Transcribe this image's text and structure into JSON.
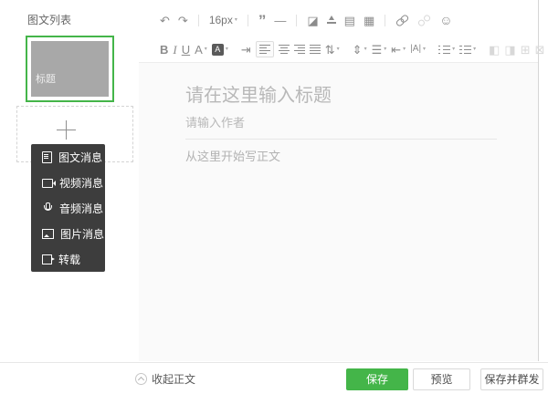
{
  "sidebar": {
    "title": "图文列表",
    "card": {
      "label": "标题"
    },
    "menu": {
      "items": [
        {
          "icon": "article-icon",
          "label": "图文消息"
        },
        {
          "icon": "video-icon",
          "label": "视频消息"
        },
        {
          "icon": "audio-icon",
          "label": "音频消息"
        },
        {
          "icon": "picture-icon",
          "label": "图片消息"
        },
        {
          "icon": "repost-icon",
          "label": "转载"
        }
      ]
    }
  },
  "toolbar": {
    "font_size": "16px",
    "icons": {
      "caret": "▾",
      "undo": "↶",
      "redo": "↷",
      "blockquote": "”",
      "hr": "—",
      "eraser": "◪",
      "brush": "css-shape",
      "template": "▤",
      "material": "▦",
      "link": "css-shape",
      "unlink": "css-shape",
      "emoji": "☺",
      "bold": "B",
      "italic": "I",
      "underline": "U",
      "font_color": "A",
      "bg_color": "A",
      "indent": "⇥",
      "align_left": "css-shape",
      "align_center": "css-shape",
      "align_right": "css-shape",
      "align_justify": "css-shape",
      "line_height": "⇅",
      "para_spacing": "⇕",
      "letter_spacing": "☰",
      "outdent": "⇤",
      "case": "|A|",
      "ul": "css-shape",
      "ol": "css-shape",
      "img_layout_a": "◧",
      "img_layout_b": "◨",
      "img_layout_c": "⊞",
      "img_layout_d": "⊠"
    }
  },
  "editor": {
    "title_placeholder": "请在这里输入标题",
    "author_placeholder": "请输入作者",
    "body_placeholder": "从这里开始写正文"
  },
  "footer": {
    "collapse_label": "收起正文",
    "save_label": "保存",
    "preview_label": "预览",
    "save_send_label": "保存并群发"
  },
  "colors": {
    "accent_green": "#44b549",
    "menu_bg": "#3d3d3d",
    "placeholder_gray": "#b8b8b8"
  }
}
